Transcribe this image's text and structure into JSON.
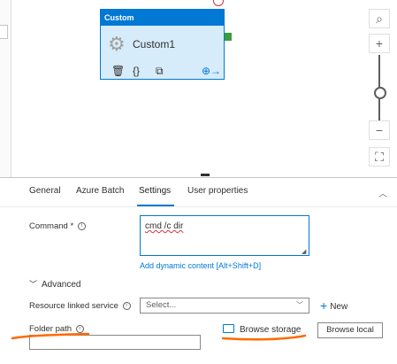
{
  "activity": {
    "type_label": "Custom",
    "name": "Custom1",
    "icons": [
      "trash-icon",
      "braces-icon",
      "copy-icon",
      "arrow-forward-icon"
    ]
  },
  "tabs": [
    {
      "label": "General"
    },
    {
      "label": "Azure Batch"
    },
    {
      "label": "Settings",
      "active": true
    },
    {
      "label": "User properties"
    }
  ],
  "settings": {
    "command_label": "Command",
    "required_mark": "*",
    "command_value": "cmd /c dir",
    "dynamic_content_link": "Add dynamic content [Alt+Shift+D]",
    "advanced_label": "Advanced",
    "linked_service_label": "Resource linked service",
    "linked_service_placeholder": "Select...",
    "new_label": "New",
    "folder_path_label": "Folder path",
    "folder_path_value": "",
    "browse_storage_label": "Browse storage",
    "browse_local_label": "Browse local"
  },
  "colors": {
    "accent": "#0078d4",
    "activity_fill": "#d6ecfa",
    "annotation": "#ff6a00",
    "port": "#3a9f3a"
  }
}
